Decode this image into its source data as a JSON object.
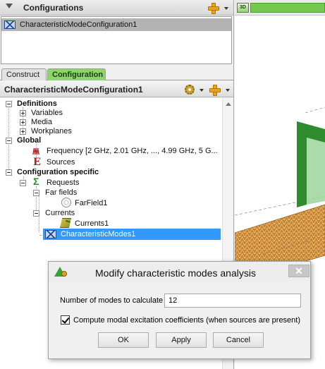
{
  "configurations_panel": {
    "title": "Configurations",
    "items": [
      {
        "label": "CharacteristicModeConfiguration1"
      }
    ]
  },
  "tabs": [
    {
      "label": "Construct",
      "active": false
    },
    {
      "label": "Configuration",
      "active": true
    }
  ],
  "config_header": {
    "title": "CharacteristicModeConfiguration1"
  },
  "tree": {
    "definitions": {
      "label": "Definitions",
      "children": [
        "Variables",
        "Media",
        "Workplanes"
      ]
    },
    "global": {
      "label": "Global",
      "frequency": "Frequency [2 GHz, 2.01 GHz, ..., 4.99 GHz, 5 G...",
      "sources": "Sources"
    },
    "config_specific": {
      "label": "Configuration specific",
      "requests": "Requests",
      "far_fields": "Far fields",
      "farfield1": "FarField1",
      "currents": "Currents",
      "currents1": "Currents1",
      "characteristic_modes": "CharacteristicModes1"
    }
  },
  "view3d": {
    "badge": "3D"
  },
  "dialog": {
    "title": "Modify characteristic modes analysis",
    "close": "✕",
    "modes_label": "Number of modes to calculate",
    "modes_value": "12",
    "checkbox_label": "Compute modal excitation coefficients (when sources are present)",
    "checkbox_checked": true,
    "buttons": {
      "ok": "OK",
      "apply": "Apply",
      "cancel": "Cancel"
    }
  },
  "colors": {
    "accent_green": "#8ed36d",
    "selection_blue": "#3399ff",
    "plate_green": "#2e8b2e",
    "ground_orange": "#c8832c"
  }
}
